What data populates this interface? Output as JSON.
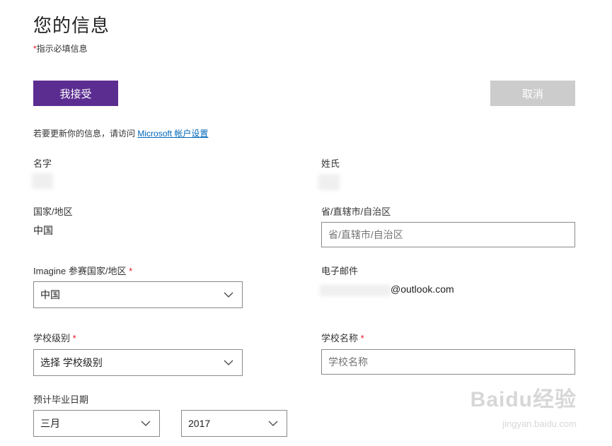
{
  "header": {
    "title": "您的信息",
    "required_star": "*",
    "required_note": "指示必填信息"
  },
  "actions": {
    "accept_label": "我接受",
    "cancel_label": "取消"
  },
  "info": {
    "text": "若要更新你的信息，请访问",
    "link": "Microsoft 帐户设置"
  },
  "form": {
    "first_name": {
      "label": "名字"
    },
    "last_name": {
      "label": "姓氏"
    },
    "country": {
      "label": "国家/地区",
      "value": "中国"
    },
    "province": {
      "label": "省/直辖市/自治区",
      "placeholder": "省/直辖市/自治区"
    },
    "imagine_country": {
      "label": "Imagine 参赛国家/地区",
      "required": "*",
      "value": "中国"
    },
    "email": {
      "label": "电子邮件",
      "value_suffix": "@outlook.com"
    },
    "school_level": {
      "label": "学校级别",
      "required": "*",
      "value": "选择 学校级别"
    },
    "school_name": {
      "label": "学校名称",
      "required": "*",
      "placeholder": "学校名称"
    },
    "graduation": {
      "label": "预计毕业日期",
      "month": "三月",
      "year": "2017"
    }
  },
  "watermark": {
    "brand": "Baidu经验",
    "url": "jingyan.baidu.com"
  },
  "colors": {
    "accent": "#5c2d91",
    "disabled": "#cccccc",
    "link": "#0067b8",
    "required": "#e81123"
  }
}
